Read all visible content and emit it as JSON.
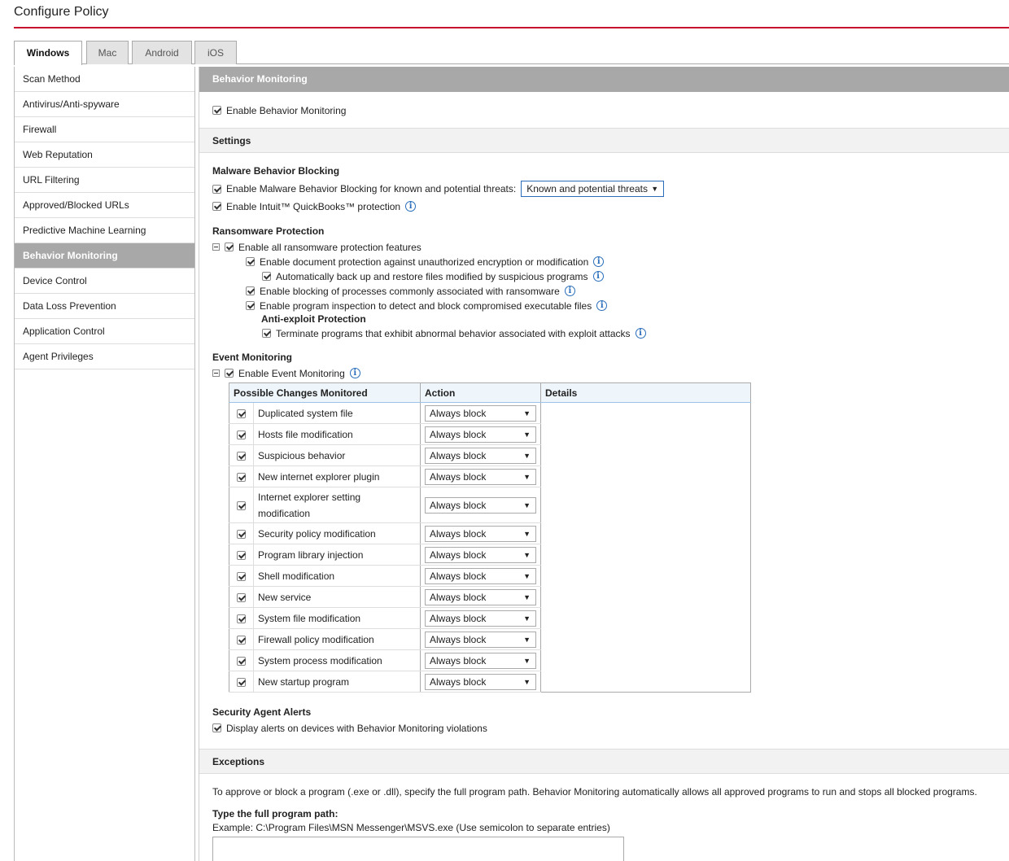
{
  "page_title": "Configure Policy",
  "tabs": [
    {
      "label": "Windows",
      "active": true
    },
    {
      "label": "Mac",
      "active": false
    },
    {
      "label": "Android",
      "active": false
    },
    {
      "label": "iOS",
      "active": false
    }
  ],
  "sidebar": {
    "items": [
      {
        "label": "Scan Method"
      },
      {
        "label": "Antivirus/Anti-spyware"
      },
      {
        "label": "Firewall"
      },
      {
        "label": "Web Reputation"
      },
      {
        "label": "URL Filtering"
      },
      {
        "label": "Approved/Blocked URLs"
      },
      {
        "label": "Predictive Machine Learning"
      },
      {
        "label": "Behavior Monitoring",
        "active": true
      },
      {
        "label": "Device Control"
      },
      {
        "label": "Data Loss Prevention"
      },
      {
        "label": "Application Control"
      },
      {
        "label": "Agent Privileges"
      }
    ]
  },
  "main": {
    "header": "Behavior Monitoring",
    "enable_label": "Enable Behavior Monitoring",
    "settings_header": "Settings",
    "malware": {
      "title": "Malware Behavior Blocking",
      "enable_label": "Enable Malware Behavior Blocking for known and potential threats:",
      "threat_select": "Known and potential threats",
      "quickbooks_label": "Enable Intuit™ QuickBooks™ protection"
    },
    "ransomware": {
      "title": "Ransomware Protection",
      "enable_all": "Enable all ransomware protection features",
      "doc_protection": "Enable document protection against unauthorized encryption or modification",
      "backup_restore": "Automatically back up and restore files modified by suspicious programs",
      "block_processes": "Enable blocking of processes commonly associated with ransomware",
      "program_inspection": "Enable program inspection to detect and block compromised executable files",
      "anti_exploit_title": "Anti-exploit Protection",
      "terminate_programs": "Terminate programs that exhibit abnormal behavior associated with exploit attacks"
    },
    "event_monitoring": {
      "title": "Event Monitoring",
      "enable_label": "Enable Event Monitoring",
      "columns": [
        "Possible Changes Monitored",
        "Action",
        "Details"
      ],
      "rows": [
        {
          "name": "Duplicated system file",
          "action": "Always block"
        },
        {
          "name": "Hosts file modification",
          "action": "Always block"
        },
        {
          "name": "Suspicious behavior",
          "action": "Always block"
        },
        {
          "name": "New internet explorer plugin",
          "action": "Always block"
        },
        {
          "name": "Internet explorer setting modification",
          "action": "Always block"
        },
        {
          "name": "Security policy modification",
          "action": "Always block"
        },
        {
          "name": "Program library injection",
          "action": "Always block"
        },
        {
          "name": "Shell modification",
          "action": "Always block"
        },
        {
          "name": "New service",
          "action": "Always block"
        },
        {
          "name": "System file modification",
          "action": "Always block"
        },
        {
          "name": "Firewall policy modification",
          "action": "Always block"
        },
        {
          "name": "System process modification",
          "action": "Always block"
        },
        {
          "name": "New startup program",
          "action": "Always block"
        }
      ]
    },
    "alerts": {
      "title": "Security Agent Alerts",
      "display_label": "Display alerts on devices with Behavior Monitoring violations"
    },
    "exceptions": {
      "header": "Exceptions",
      "description": "To approve or block a program (.exe or .dll), specify the full program path. Behavior Monitoring automatically allows all approved programs to run and stops all blocked programs.",
      "path_label": "Type the full program path:",
      "example": "Example: C:\\Program Files\\MSN Messenger\\MSVS.exe (Use semicolon to separate entries)",
      "path_value": ""
    }
  }
}
